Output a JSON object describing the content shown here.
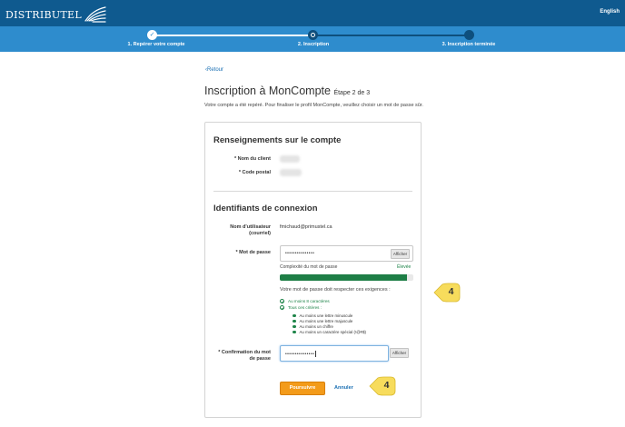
{
  "header": {
    "brand": "DISTRIBUTEL",
    "language_link": "English",
    "colors": {
      "bar": "#0f5a8f",
      "stepper": "#2e8ccd"
    }
  },
  "stepper": {
    "steps": [
      {
        "label": "1. Repérer votre compte",
        "state": "done"
      },
      {
        "label": "2. Inscription",
        "state": "current"
      },
      {
        "label": "3. Inscription terminée",
        "state": "pending"
      }
    ],
    "check_glyph": "✓"
  },
  "page": {
    "back_link": "Retour",
    "title": "Inscription à MonCompte",
    "step_hint": "Étape 2 de 3",
    "intro": "Votre compte a été repéré. Pour finaliser le profil MonCompte, veuillez choisir un mot de passe sûr."
  },
  "account_section": {
    "title": "Renseignements sur le compte",
    "client_name_label": "* Nom du client",
    "postal_code_label": "* Code postal"
  },
  "login_section": {
    "title": "Identifiants de connexion",
    "username_label_line1": "Nom d'utilisateur",
    "username_label_line2": "(courriel)",
    "username_value": "fmichaud@primustel.ca",
    "password_label": "* Mot de passe",
    "password_mask": "•••••••••••••••",
    "show_button": "Afficher",
    "complexity_label": "Complexité du mot de passe",
    "complexity_level": "Élevée",
    "complexity_fraction": 0.95,
    "requirements_title": "Votre mot de passe doit respecter ces exigences :",
    "requirements": [
      "Au moins 8 caractères",
      "Tous ces critères :"
    ],
    "criteria": [
      "Au moins une lettre minuscule",
      "Au moins une lettre majuscule",
      "Au moins un chiffre",
      "Au moins un caractère spécial (!@#$)"
    ],
    "confirm_label_line1": "* Confirmation du mot",
    "confirm_label_line2": "de passe",
    "confirm_mask": "•••••••••••••••",
    "continue_button": "Poursuivre",
    "cancel_link": "Annuler"
  },
  "callouts": {
    "first": "4",
    "second": "4",
    "color": "#f7dc5c"
  }
}
